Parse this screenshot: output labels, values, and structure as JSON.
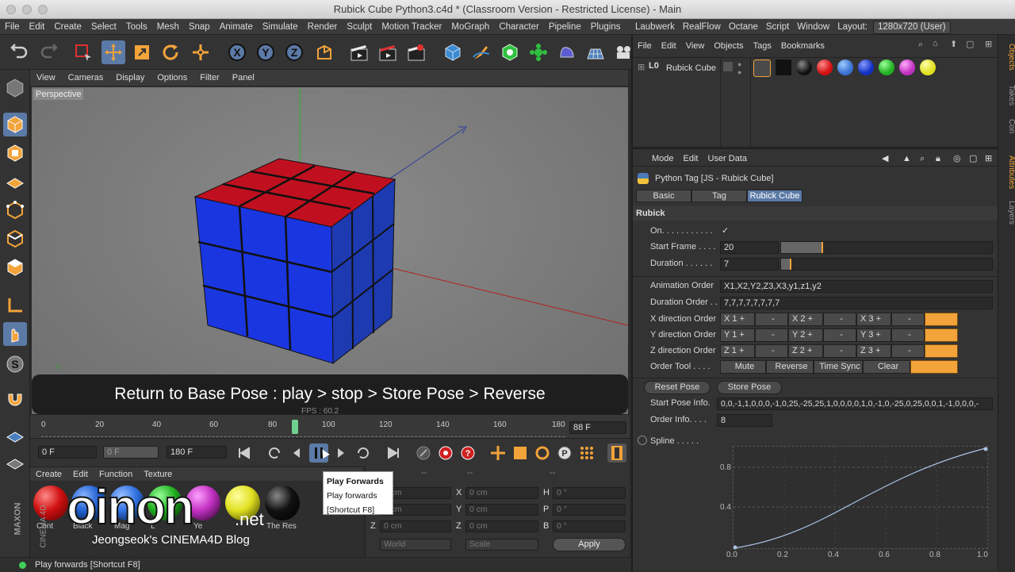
{
  "window": {
    "title": "Rubick Cube Python3.c4d * (Classroom Version - Restricted License) - Main"
  },
  "menubar": {
    "items": [
      "File",
      "Edit",
      "Create",
      "Select",
      "Tools",
      "Mesh",
      "Snap",
      "Animate",
      "Simulate",
      "Render",
      "Sculpt",
      "Motion Tracker",
      "MoGraph",
      "Character",
      "Pipeline",
      "Plugins",
      "Laubwerk",
      "RealFlow",
      "Octane",
      "Script",
      "Window"
    ],
    "layout_label": "Layout:",
    "layout_value": "1280x720 (User)"
  },
  "viewport": {
    "menu": [
      "View",
      "Cameras",
      "Display",
      "Options",
      "Filter",
      "Panel"
    ],
    "label": "Perspective",
    "fps": "FPS : 60.2",
    "axis_y": "Y"
  },
  "subtitle": "Return to Base Pose : play > stop > Store Pose > Reverse",
  "timeline": {
    "ticks": [
      "0",
      "20",
      "40",
      "60",
      "80",
      "100",
      "120",
      "140",
      "160",
      "180"
    ],
    "current_frame": "88 F"
  },
  "transport": {
    "start": "0 F",
    "mid": "0 F",
    "end": "180 F"
  },
  "tooltip": {
    "title": "Play Forwards",
    "desc": "Play forwards",
    "shortcut": "[Shortcut F8]"
  },
  "material_manager": {
    "menu": [
      "Create",
      "Edit",
      "Function",
      "Texture"
    ],
    "names": [
      "Cont",
      "Black",
      "Mag",
      "L",
      "Ye",
      "The Res"
    ],
    "colors": [
      "#d01010",
      "#2060d0",
      "#3070e0",
      "#20b020",
      "#c030c0",
      "#e0e020",
      "#111111"
    ]
  },
  "coords": {
    "dashes": [
      "--",
      "--",
      "--"
    ],
    "rows": [
      {
        "l1": "X",
        "v1": "0 cm",
        "l2": "X",
        "v2": "0 cm",
        "l3": "H",
        "v3": "0 °"
      },
      {
        "l1": "Y",
        "v1": "0 cm",
        "l2": "Y",
        "v2": "0 cm",
        "l3": "P",
        "v3": "0 °"
      },
      {
        "l1": "Z",
        "v1": "0 cm",
        "l2": "Z",
        "v2": "0 cm",
        "l3": "B",
        "v3": "0 °"
      }
    ],
    "world": "World",
    "scale": "Scale",
    "apply": "Apply"
  },
  "watermark": {
    "brand": "oinon",
    "net": ".net",
    "byline": "Jeongseok's CINEMA4D Blog",
    "maxon": "MAXON",
    "cinema": "CINEMA 4D"
  },
  "statusbar": "Play forwards [Shortcut F8]",
  "object_manager": {
    "menu": [
      "File",
      "Edit",
      "View",
      "Objects",
      "Tags",
      "Bookmarks"
    ],
    "object_name": "Rubick Cube",
    "tag_colors": [
      "#111111",
      "#d01010",
      "#3a70d0",
      "#1030c0",
      "#20b020",
      "#c030c0",
      "#e0e020"
    ]
  },
  "attributes": {
    "menu": [
      "Mode",
      "Edit",
      "User Data"
    ],
    "header": "Python Tag [JS - Rubick Cube]",
    "tabs": [
      "Basic",
      "Tag",
      "Rubick Cube"
    ],
    "section": "Rubick",
    "on_label": "On. . . . . . . . . . .",
    "on_value": "✓",
    "start_frame_label": "Start Frame . . . .",
    "start_frame_value": "20",
    "start_frame_fraction": 0.2,
    "duration_label": "Duration . . . . . .",
    "duration_value": "7",
    "duration_fraction": 0.05,
    "anim_order_label": "Animation Order",
    "anim_order_value": "X1,X2,Y2,Z3,X3,y1,z1,y2",
    "dur_order_label": "Duration Order . .",
    "dur_order_value": "7,7,7,7,7,7,7,7",
    "dir_rows": [
      {
        "label": "X direction Order",
        "b1": "X 1 +",
        "b2": "-",
        "b3": "X 2 +",
        "b4": "-",
        "b5": "X 3 +",
        "b6": "-"
      },
      {
        "label": "Y direction Order",
        "b1": "Y 1 +",
        "b2": "-",
        "b3": "Y 2 +",
        "b4": "-",
        "b5": "Y 3 +",
        "b6": "-"
      },
      {
        "label": "Z direction Order",
        "b1": "Z 1 +",
        "b2": "-",
        "b3": "Z 2 +",
        "b4": "-",
        "b5": "Z 3 +",
        "b6": "-"
      }
    ],
    "order_tool_label": "Order Tool . . . .",
    "order_tool_buttons": [
      "Mute",
      "Reverse",
      "Time Sync",
      "Clear"
    ],
    "reset_pose": "Reset Pose",
    "store_pose": "Store Pose",
    "start_pose_label": "Start Pose Info.",
    "start_pose_value": "0,0,-1,1,0,0,0,-1,0,25,-25,25,1,0,0,0,0,1,0,-1,0,-25,0,25,0,0,1,-1,0,0,0,-",
    "order_info_label": "Order Info. . . .",
    "order_info_value": "8",
    "spline_label": "Spline . . . . .",
    "spline_y_ticks": [
      "0.8",
      "0.4"
    ],
    "spline_x_ticks": [
      "0.0",
      "0.2",
      "0.4",
      "0.6",
      "0.8",
      "1.0"
    ]
  },
  "side_tabs": [
    "Objects",
    "Takes",
    "Con",
    "Attributes",
    "Layers"
  ],
  "accent": "#f2a33a",
  "selection": "#5c7aa6"
}
